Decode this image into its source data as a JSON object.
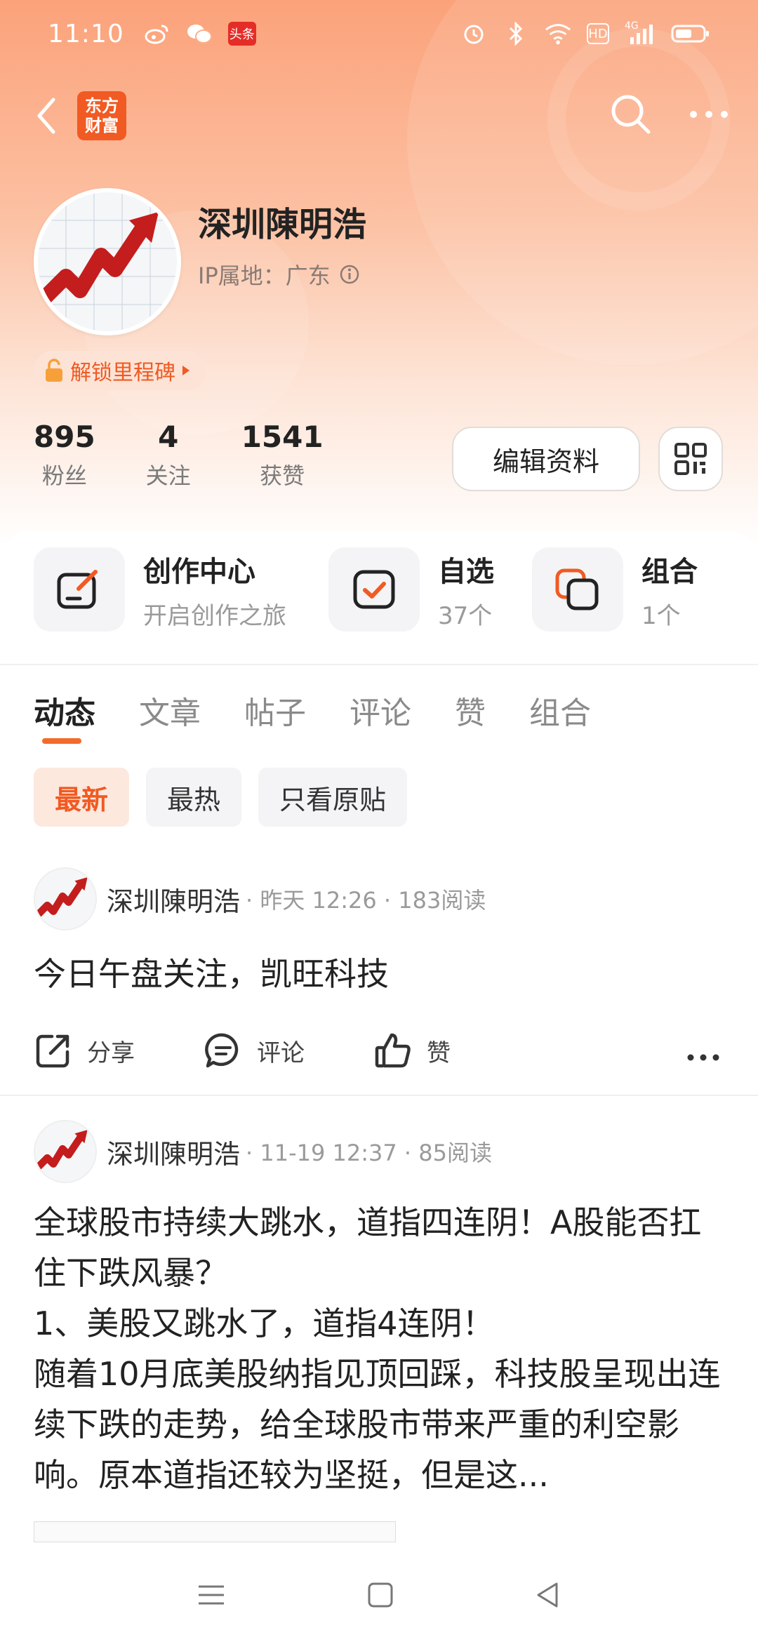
{
  "status_bar": {
    "time": "11:10",
    "toutiao_label": "头条",
    "network_label": "HD",
    "signal_label": "4G"
  },
  "nav": {
    "brand_line1": "东方",
    "brand_line2": "财富"
  },
  "profile": {
    "name": "深圳陳明浩",
    "ip_label": "IP属地：广东",
    "milestone_label": "解锁里程碑",
    "stats": [
      {
        "num": "895",
        "label": "粉丝"
      },
      {
        "num": "4",
        "label": "关注"
      },
      {
        "num": "1541",
        "label": "获赞"
      }
    ],
    "edit_label": "编辑资料"
  },
  "quick": [
    {
      "title": "创作中心",
      "sub": "开启创作之旅",
      "icon": "create-icon"
    },
    {
      "title": "自选",
      "sub": "37个",
      "icon": "checkbox-icon"
    },
    {
      "title": "组合",
      "sub": "1个",
      "icon": "portfolio-icon"
    }
  ],
  "tabs": [
    "动态",
    "文章",
    "帖子",
    "评论",
    "赞",
    "组合"
  ],
  "filters": [
    "最新",
    "最热",
    "只看原贴"
  ],
  "posts": [
    {
      "author": "深圳陳明浩",
      "meta": "· 昨天 12:26 · 183阅读",
      "text": "今日午盘关注，凯旺科技",
      "share": "分享",
      "comment": "评论",
      "like": "赞"
    },
    {
      "author": "深圳陳明浩",
      "meta": "· 11-19 12:37 · 85阅读",
      "text": "全球股市持续大跳水，道指四连阴！A股能否扛住下跌风暴？\n1、美股又跳水了，道指4连阴！\n随着10月底美股纳指见顶回踩，科技股呈现出连续下跌的走势，给全球股市带来严重的利空影响。原本道指还较为坚挺，但是这..."
    }
  ],
  "colors": {
    "accent": "#f15a22",
    "header_top": "#fba27a"
  }
}
